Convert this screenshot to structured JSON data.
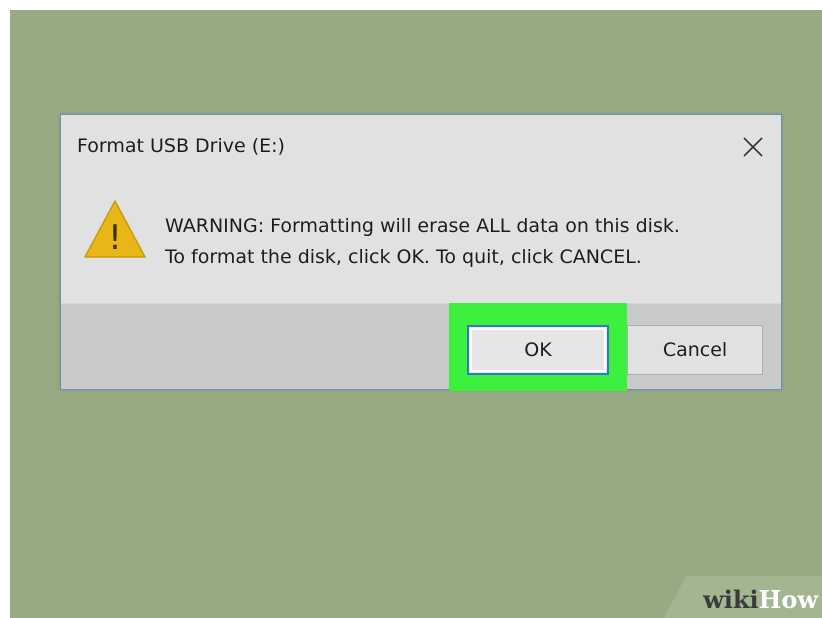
{
  "dialog": {
    "title": "Format USB Drive (E:)",
    "message_line1": "WARNING: Formatting will erase ALL data on this disk.",
    "message_line2": "To format the disk, click OK. To quit, click CANCEL.",
    "warning_icon_glyph": "!",
    "icons": {
      "close": "close-icon",
      "warning": "warning-icon"
    }
  },
  "buttons": {
    "ok_label": "OK",
    "cancel_label": "Cancel"
  },
  "watermark": {
    "part1": "wiki",
    "part2": "How"
  },
  "colors": {
    "background": "#97aa84",
    "dialog_bg": "#e1e1e1",
    "button_bar_bg": "#c9c9c9",
    "highlight": "#3df03d",
    "focus_border": "#2f77c9",
    "warning_yellow": "#e8b717"
  }
}
